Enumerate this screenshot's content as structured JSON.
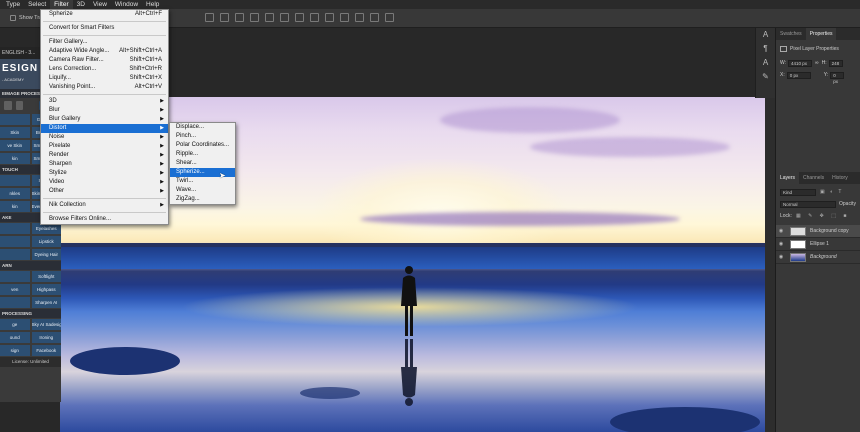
{
  "menubar": [
    "Type",
    "Select",
    "Filter",
    "3D",
    "View",
    "Window",
    "Help"
  ],
  "options": {
    "show_transform": "Show Transf"
  },
  "filter_menu": {
    "items": [
      {
        "label": "Spherize",
        "shortcut": "Alt+Ctrl+F"
      },
      {
        "sep": true
      },
      {
        "label": "Convert for Smart Filters",
        "shortcut": ""
      },
      {
        "sep": true
      },
      {
        "label": "Filter Gallery...",
        "shortcut": ""
      },
      {
        "label": "Adaptive Wide Angle...",
        "shortcut": "Alt+Shift+Ctrl+A"
      },
      {
        "label": "Camera Raw Filter...",
        "shortcut": "Shift+Ctrl+A"
      },
      {
        "label": "Lens Correction...",
        "shortcut": "Shift+Ctrl+R"
      },
      {
        "label": "Liquify...",
        "shortcut": "Shift+Ctrl+X"
      },
      {
        "label": "Vanishing Point...",
        "shortcut": "Alt+Ctrl+V"
      },
      {
        "sep": true
      },
      {
        "label": "3D",
        "sub": true
      },
      {
        "label": "Blur",
        "sub": true
      },
      {
        "label": "Blur Gallery",
        "sub": true
      },
      {
        "label": "Distort",
        "sub": true,
        "hl": true
      },
      {
        "label": "Noise",
        "sub": true
      },
      {
        "label": "Pixelate",
        "sub": true
      },
      {
        "label": "Render",
        "sub": true
      },
      {
        "label": "Sharpen",
        "sub": true
      },
      {
        "label": "Stylize",
        "sub": true
      },
      {
        "label": "Video",
        "sub": true
      },
      {
        "label": "Other",
        "sub": true
      },
      {
        "sep": true
      },
      {
        "label": "Nik Collection",
        "sub": true
      },
      {
        "sep": true
      },
      {
        "label": "Browse Filters Online...",
        "shortcut": ""
      }
    ]
  },
  "distort_menu": [
    "Displace...",
    "Pinch...",
    "Polar Coordinates...",
    "Ripple...",
    "Shear...",
    "Spherize...",
    "Twirl...",
    "Wave...",
    "ZigZag..."
  ],
  "distort_highlight": "Spherize...",
  "left_panel": {
    "header": "ENGLISH - 3...",
    "logo_main": "ESIGN",
    "logo_sub": "- ACADEMY",
    "section_image": "EIMAGE PROCESS",
    "gaussian": "Gaussian",
    "row_brightener": [
      "Skin",
      "Brightener"
    ],
    "row_smooth1": [
      "ve Skin",
      "Smooth Skin"
    ],
    "row_smooth2": [
      "kin",
      "Smooth Skin"
    ],
    "section_touch": "TOUCH",
    "row_smooth3": [
      "",
      "Smooth"
    ],
    "row_color": [
      "nkles",
      "Skin Color Scales"
    ],
    "row_even": [
      "kin",
      "Even Skin Tone"
    ],
    "section_makeup": "AKE",
    "row_eyelash": [
      "",
      "Eyelashes"
    ],
    "row_lipstick": [
      "",
      "Lipstick"
    ],
    "row_hair": [
      "",
      "Dyeing Hair"
    ],
    "section_learn": "ARN",
    "row_softlight": [
      "",
      "Softlight"
    ],
    "row_highpass": [
      "ven",
      "Highpass"
    ],
    "row_sharpen": [
      "",
      "Sharpen AI"
    ],
    "section_processing": "PROCESSING",
    "row_sky": [
      "ge",
      "Sky AI Sadesign"
    ],
    "row_ironing": [
      "ound",
      "Ironing"
    ],
    "row_facebook": [
      "sign",
      "Facebook"
    ],
    "footer": "License: Unlimited"
  },
  "right_panel": {
    "tabs_top": [
      "Swatches",
      "Properties"
    ],
    "pixel_layer": "Pixel Layer Properties",
    "w_label": "W:",
    "w_value": "4410 px",
    "h_label": "H:",
    "h_value": "248",
    "x_label": "X:",
    "x_value": "0 px",
    "y_label": "Y:",
    "y_value": "0 px",
    "tabs_layers": [
      "Layers",
      "Channels",
      "History"
    ],
    "kind": "Kind",
    "blend": "Normal",
    "opacity": "Opacity",
    "lock": "Lock:",
    "layers": [
      "Background copy",
      "Ellipse 1",
      "Background"
    ]
  }
}
